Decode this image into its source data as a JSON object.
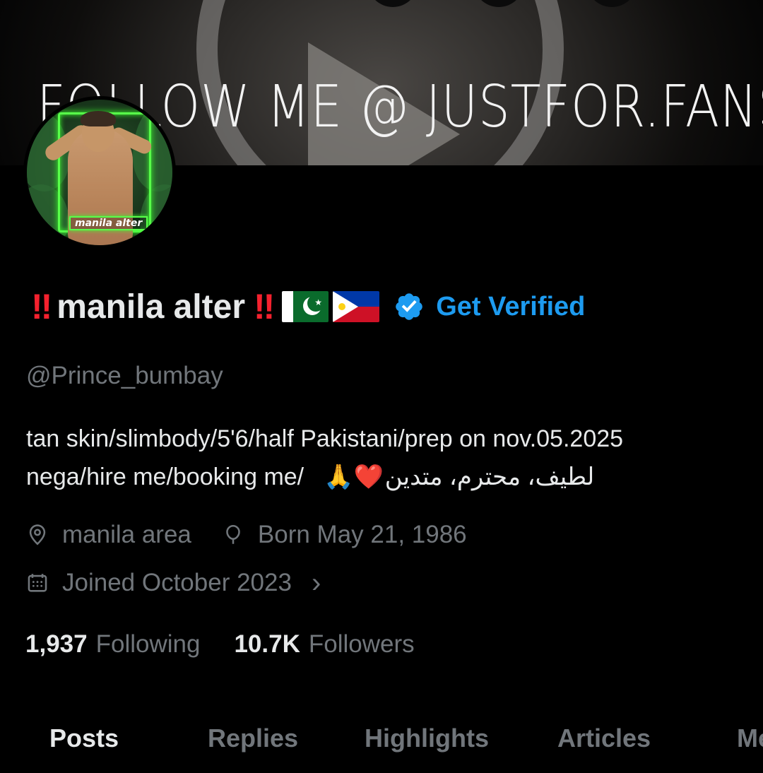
{
  "banner": {
    "text": "FOLLOW ME @ JUSTFOR.FANS"
  },
  "avatar": {
    "caption": "manila alter"
  },
  "profile": {
    "bang_left": "‼",
    "name": "manila alter",
    "bang_right": "‼",
    "flags": [
      "pakistan-flag-icon",
      "philippines-flag-icon"
    ],
    "get_verified_label": "Get Verified",
    "handle": "@Prince_bumbay"
  },
  "bio": {
    "line1": "tan skin/slimbody/5'6/half Pakistani/prep on nov.05.2025",
    "line2_text": "nega/hire me/booking me/",
    "line2_emoji": "🙏❤️",
    "line2_arabic": "لطيف، محترم، متدين"
  },
  "meta": {
    "location": "manila area",
    "birthday": "Born May 21, 1986",
    "joined": "Joined October 2023",
    "joined_chevron": "›"
  },
  "stats": {
    "following_count": "1,937",
    "following_label": "Following",
    "followers_count": "10.7K",
    "followers_label": "Followers"
  },
  "tabs": [
    {
      "label": "Posts"
    },
    {
      "label": "Replies"
    },
    {
      "label": "Highlights"
    },
    {
      "label": "Articles"
    },
    {
      "label": "Media"
    }
  ],
  "colors": {
    "background": "#000000",
    "primary_text": "#e7e9ea",
    "secondary_text": "#71767b",
    "accent_blue": "#1d9bf0",
    "bang_red": "#f4212e"
  }
}
